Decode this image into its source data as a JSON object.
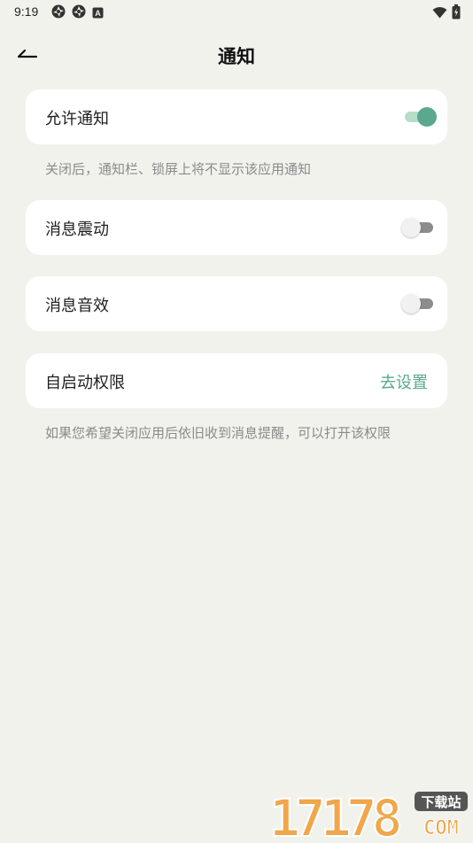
{
  "status_bar": {
    "time": "9:19",
    "left_icons": [
      "settings-gear-icon",
      "settings-gear-icon",
      "a-badge-icon"
    ],
    "right_icons": [
      "wifi-icon",
      "battery-icon"
    ],
    "badge_letter": "A"
  },
  "header": {
    "title": "通知",
    "back_icon": "back-arrow-icon"
  },
  "settings": {
    "allow_notifications": {
      "label": "允许通知",
      "enabled": true,
      "hint": "关闭后，通知栏、锁屏上将不显示该应用通知"
    },
    "message_vibration": {
      "label": "消息震动",
      "enabled": false
    },
    "message_sound": {
      "label": "消息音效",
      "enabled": false
    },
    "auto_start": {
      "label": "自启动权限",
      "action_label": "去设置",
      "hint": "如果您希望关闭应用后依旧收到消息提醒，可以打开该权限"
    }
  },
  "watermark": {
    "digits": "17178",
    "tag": "下载站",
    "suffix": "COM"
  },
  "colors": {
    "background": "#f2f2ed",
    "card": "#ffffff",
    "accent": "#5ba88e",
    "toggle_on_track": "#b6ddc9",
    "toggle_off_track": "#8c8c8c",
    "hint_text": "#8a8a8a"
  }
}
